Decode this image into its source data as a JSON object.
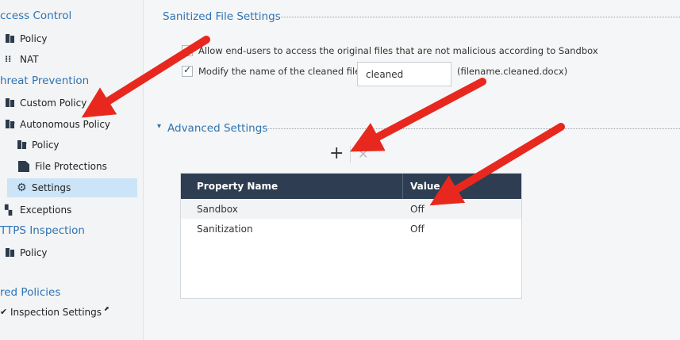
{
  "sidebar": {
    "access_control": "ccess Control",
    "ac_policy": "Policy",
    "ac_nat": "NAT",
    "threat_prevention": "hreat Prevention",
    "tp_custom_policy": "Custom Policy",
    "tp_autonomous_policy": "Autonomous Policy",
    "ap_policy": "Policy",
    "ap_file_protections": "File Protections",
    "ap_settings": "Settings",
    "tp_exceptions": "Exceptions",
    "https_inspection": "TTPS Inspection",
    "hi_policy": "Policy",
    "shared_policies": "red Policies",
    "sp_inspection_settings": "Inspection Settings"
  },
  "sanitized": {
    "title": "Sanitized File Settings",
    "allow_label": "Allow end-users to access the original files that are not malicious according to Sandbox",
    "allow_checked": false,
    "modify_label": "Modify the name of the cleaned file:",
    "modify_checked": true,
    "cleaned_value": "cleaned",
    "example": "(filename.cleaned.docx)"
  },
  "advanced": {
    "toggle": "▾",
    "title": "Advanced Settings",
    "add_icon": "+",
    "delete_icon": "✕",
    "columns": [
      "Property Name",
      "Value"
    ],
    "rows": [
      {
        "name": "Sandbox",
        "value": "Off"
      },
      {
        "name": "Sanitization",
        "value": "Off"
      }
    ]
  },
  "annotation_color": "#e8281e"
}
